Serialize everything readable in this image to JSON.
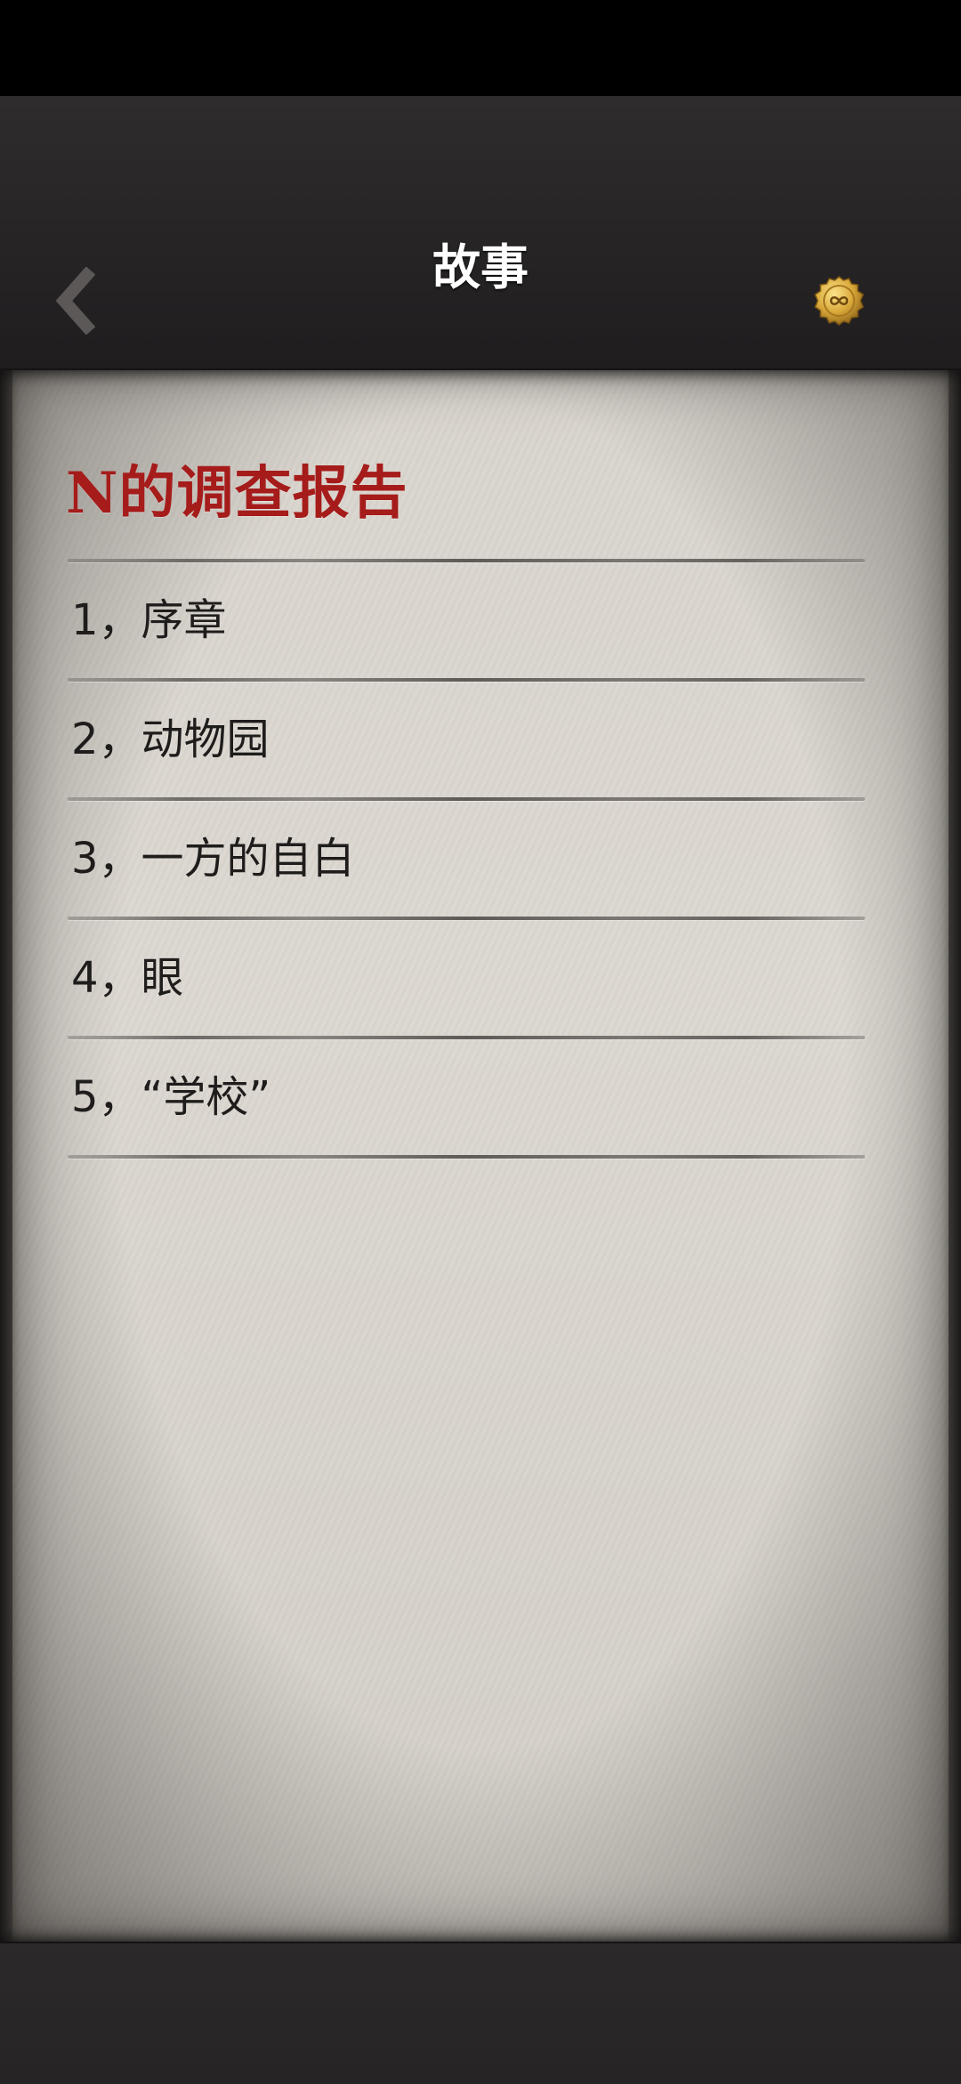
{
  "nav": {
    "title": "故事",
    "back_icon": "chevron-left-icon",
    "coin_icon": "gold-coin-icon"
  },
  "story": {
    "title": "N的调查报告",
    "chapters": [
      {
        "label": "1，序章"
      },
      {
        "label": "2，动物园"
      },
      {
        "label": "3，一方的自白"
      },
      {
        "label": "4，眼"
      },
      {
        "label": "5，“学校”"
      }
    ]
  },
  "colors": {
    "title_red": "#a51c1b",
    "nav_bg": "#262425",
    "paper": "#dcd8d1",
    "text": "#1f1d1c",
    "coin_gold": "#d9a93a"
  }
}
